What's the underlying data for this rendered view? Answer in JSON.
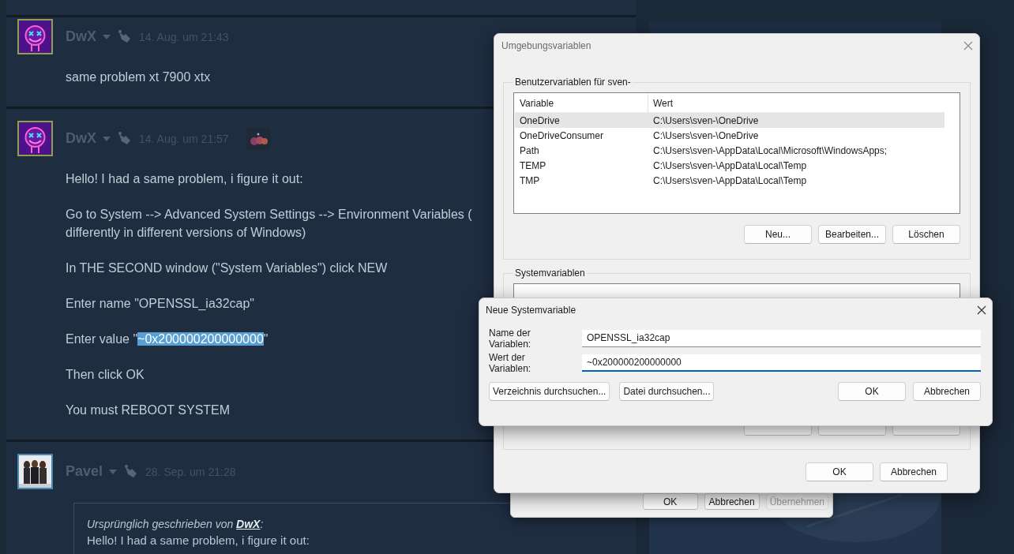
{
  "forum": {
    "posts": [
      {
        "author": "DwX",
        "avatar": {
          "kind": "neon"
        },
        "date": "14. Aug. um 21:43",
        "badge": false,
        "body": [
          {
            "kind": "text",
            "text": "same problem xt 7900 xtx"
          }
        ]
      },
      {
        "author": "DwX",
        "avatar": {
          "kind": "neon"
        },
        "date": "14. Aug. um 21:57",
        "badge": true,
        "body": [
          {
            "kind": "text",
            "text": "Hello! I had a same problem, i figure it out:"
          },
          {
            "kind": "lines",
            "lines": [
              "Go to System --> Advanced System Settings --> Environment Variables (",
              "differently in different versions of Windows)"
            ]
          },
          {
            "kind": "text",
            "text": "In THE SECOND window (\"System Variables\") click NEW"
          },
          {
            "kind": "text",
            "text": "Enter name \"OPENSSL_ia32cap\""
          },
          {
            "kind": "highlight",
            "before": "Enter value \"",
            "highlight": "~0x200000200000000",
            "after": "\""
          },
          {
            "kind": "text",
            "text": "Then click OK"
          },
          {
            "kind": "text",
            "text": "You must REBOOT SYSTEM"
          }
        ]
      },
      {
        "author": "Pavel",
        "date": "28. Sep. um 21:28",
        "badge": false,
        "quote": {
          "attribution": "Ursprünglich geschrieben von",
          "author": "DwX",
          "suffix": ":",
          "text": "Hello! I had a same problem, i figure it out:"
        }
      }
    ]
  },
  "system_properties_dialog": {
    "buttons": [
      {
        "label": "OK",
        "disabled": false
      },
      {
        "label": "Abbrechen",
        "disabled": false
      },
      {
        "label": "Übernehmen",
        "disabled": true
      }
    ]
  },
  "environment_dialog": {
    "title": "Umgebungsvariablen",
    "user_group": {
      "label": "Benutzervariablen für sven-",
      "columns": [
        "Variable",
        "Wert"
      ],
      "rows": [
        {
          "variable": "OneDrive",
          "value": "C:\\Users\\sven-\\OneDrive",
          "selected": true
        },
        {
          "variable": "OneDriveConsumer",
          "value": "C:\\Users\\sven-\\OneDrive",
          "selected": false
        },
        {
          "variable": "Path",
          "value": "C:\\Users\\sven-\\AppData\\Local\\Microsoft\\WindowsApps;",
          "selected": false
        },
        {
          "variable": "TEMP",
          "value": "C:\\Users\\sven-\\AppData\\Local\\Temp",
          "selected": false
        },
        {
          "variable": "TMP",
          "value": "C:\\Users\\sven-\\AppData\\Local\\Temp",
          "selected": false
        }
      ],
      "buttons": [
        "Neu...",
        "Bearbeiten...",
        "Löschen"
      ]
    },
    "system_group": {
      "label": "Systemvariablen"
    },
    "buttons": [
      "OK",
      "Abbrechen"
    ]
  },
  "new_variable_dialog": {
    "title": "Neue Systemvariable",
    "fields": [
      {
        "label": "Name der Variablen:",
        "value": "OPENSSL_ia32cap",
        "focused": false
      },
      {
        "label": "Wert der Variablen:",
        "value": "~0x200000200000000",
        "focused": true
      }
    ],
    "browse_buttons": [
      "Verzeichnis durchsuchen...",
      "Datei durchsuchen..."
    ],
    "buttons": [
      "OK",
      "Abbrechen"
    ]
  }
}
